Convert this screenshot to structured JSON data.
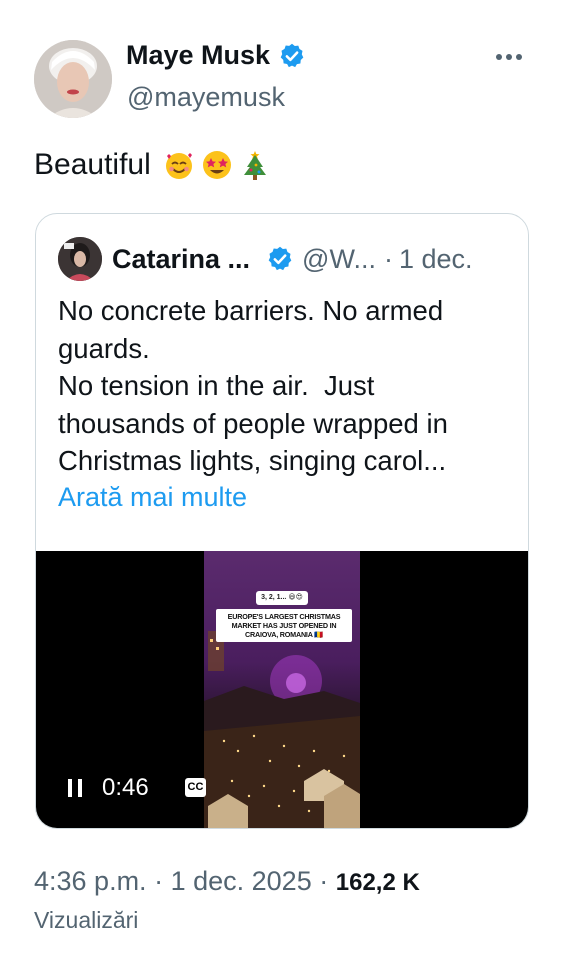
{
  "tweet": {
    "author_name": "Maye Musk",
    "author_handle": "@mayemusk",
    "text": "Beautiful",
    "emojis": [
      "smiling-face-with-hearts",
      "star-struck",
      "christmas-tree"
    ],
    "timestamp": "4:36 p.m.",
    "separator": "·",
    "date": "1 dec. 2025",
    "views_count": "162,2 K",
    "views_label": "Vizualizări"
  },
  "quote": {
    "author_name": "Catarina ...",
    "author_handle": "@W...",
    "separator": "·",
    "date": "1 dec.",
    "text_lines": [
      "No concrete barriers. No armed",
      "guards.",
      "No tension in the air.  Just",
      "thousands of people wrapped in",
      "Christmas lights, singing carol..."
    ],
    "show_more": "Arată mai multe",
    "video": {
      "time": "0:46",
      "cc_label": "CC",
      "overlay_top": "3, 2, 1... 😃😍",
      "overlay_banner": "EUROPE'S LARGEST CHRISTMAS MARKET HAS JUST OPENED IN CRAIOVA, ROMANIA 🇷🇴"
    }
  },
  "colors": {
    "verified_blue": "#1d9bf0",
    "secondary_text": "#536471",
    "link": "#1d9bf0"
  }
}
